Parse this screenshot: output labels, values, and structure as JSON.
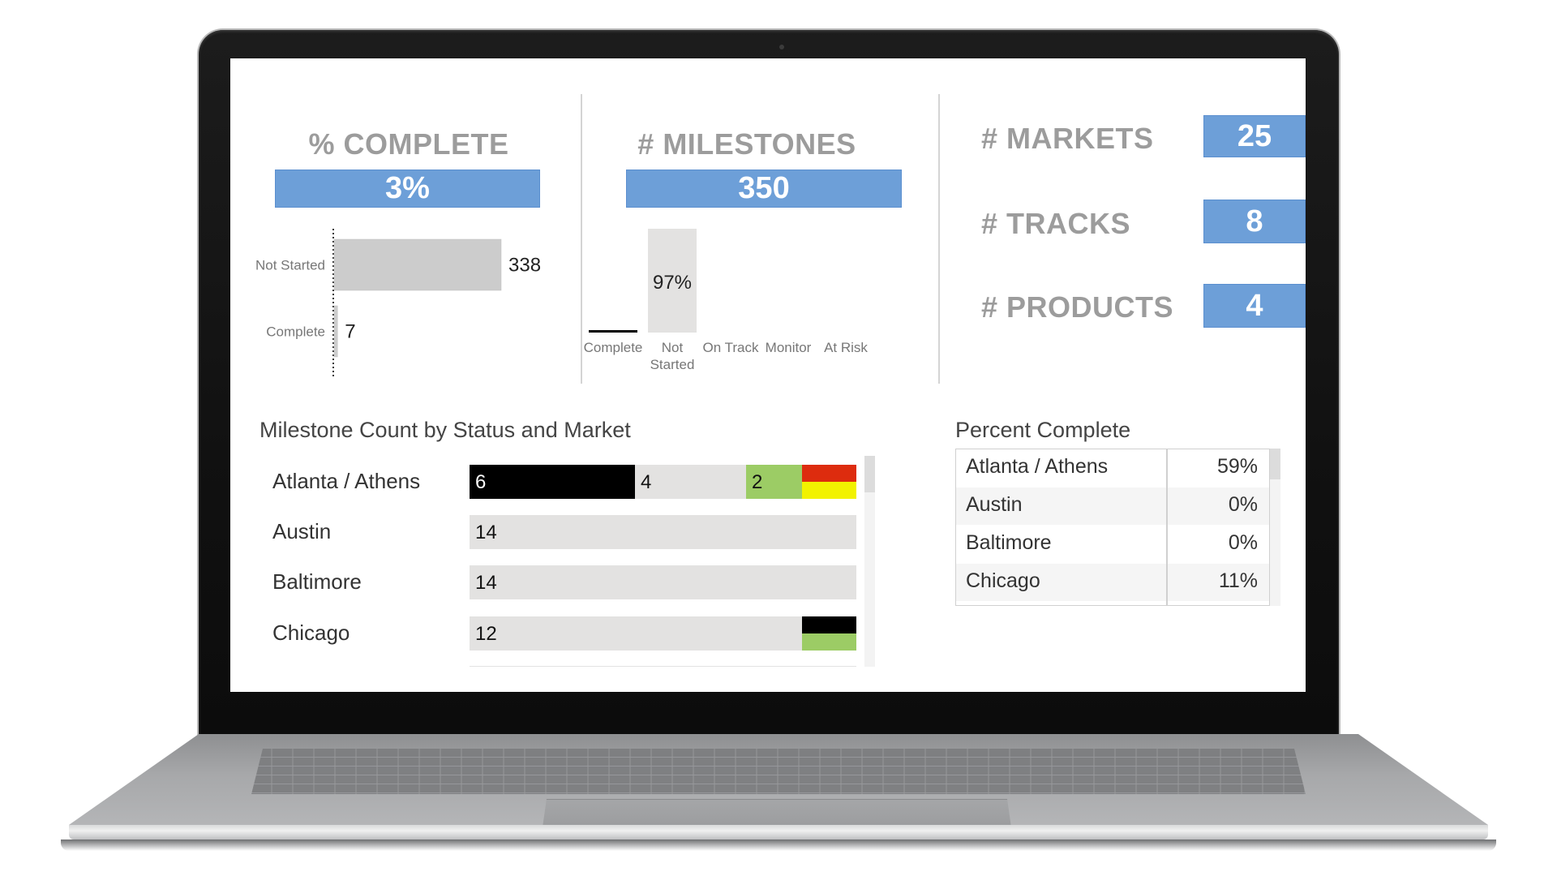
{
  "kpis": {
    "percent_complete": {
      "title": "% COMPLETE",
      "value": "3%"
    },
    "milestones": {
      "title": "# MILESTONES",
      "value": "350"
    },
    "markets": {
      "label": "# MARKETS",
      "value": "25"
    },
    "tracks": {
      "label": "# TRACKS",
      "value": "8"
    },
    "products": {
      "label": "# PRODUCTS",
      "value": "4"
    }
  },
  "chart_data": [
    {
      "type": "bar",
      "orientation": "horizontal",
      "title": "% COMPLETE",
      "categories": [
        "Not Started",
        "Complete"
      ],
      "values": [
        338,
        7
      ],
      "value_labels": [
        "338",
        "7"
      ],
      "colors": [
        "#cccccc",
        "#cccccc"
      ]
    },
    {
      "type": "bar",
      "orientation": "vertical",
      "title": "# MILESTONES",
      "categories": [
        "Complete",
        "Not Started",
        "On Track",
        "Monitor",
        "At Risk"
      ],
      "values": [
        2,
        97,
        0,
        0,
        0
      ],
      "unit": "%",
      "value_labels": [
        "",
        "97%",
        "",
        "",
        ""
      ],
      "colors": [
        "#000000",
        "#e3e2e1",
        "#9ccc65",
        "#f2f200",
        "#dd2c0e"
      ]
    },
    {
      "type": "bar",
      "orientation": "horizontal",
      "stacked": true,
      "title": "Milestone Count by Status and Market",
      "categories": [
        "Atlanta / Athens",
        "Austin",
        "Baltimore",
        "Chicago"
      ],
      "series": [
        {
          "name": "Complete",
          "color": "#000000",
          "values": [
            6,
            0,
            0,
            1
          ]
        },
        {
          "name": "Not Started",
          "color": "#e3e2e1",
          "values": [
            4,
            14,
            14,
            12
          ]
        },
        {
          "name": "On Track",
          "color": "#9ccc65",
          "values": [
            2,
            0,
            0,
            1
          ]
        },
        {
          "name": "At Risk",
          "color": "#dd2c0e",
          "values": [
            1,
            0,
            0,
            0
          ]
        },
        {
          "name": "Monitor",
          "color": "#f2f200",
          "values": [
            1,
            0,
            0,
            0
          ]
        }
      ],
      "visible_labels": [
        [
          "6",
          "4",
          "2"
        ],
        [
          "14"
        ],
        [
          "14"
        ],
        [
          "12"
        ]
      ]
    }
  ],
  "milestone_section": {
    "title": "Milestone Count by Status and Market"
  },
  "percent_complete_table": {
    "title": "Percent Complete",
    "rows": [
      {
        "market": "Atlanta / Athens",
        "percent": "59%"
      },
      {
        "market": "Austin",
        "percent": "0%"
      },
      {
        "market": "Baltimore",
        "percent": "0%"
      },
      {
        "market": "Chicago",
        "percent": "11%"
      }
    ]
  },
  "colors": {
    "kpi_blue": "#6d9fd8",
    "complete": "#000000",
    "not_started": "#e3e2e1",
    "on_track": "#9ccc65",
    "monitor": "#f2f200",
    "at_risk": "#dd2c0e"
  }
}
